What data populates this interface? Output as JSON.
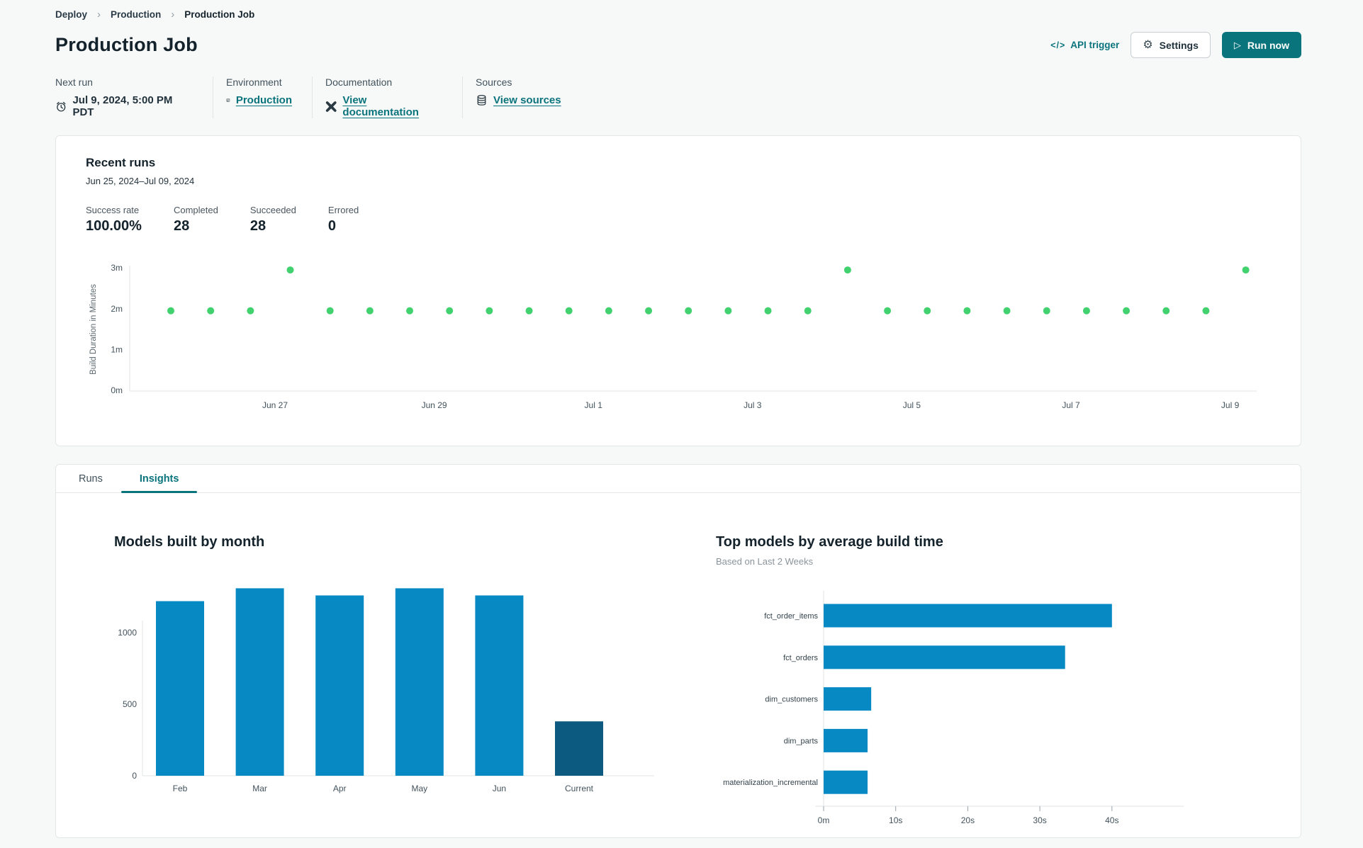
{
  "breadcrumb": {
    "items": [
      "Deploy",
      "Production",
      "Production Job"
    ],
    "separator": "›"
  },
  "header": {
    "title": "Production Job",
    "api_trigger": {
      "glyph": "</>",
      "label": "API trigger"
    },
    "settings": {
      "glyph": "⚙",
      "label": "Settings"
    },
    "run_now": {
      "glyph": "▷",
      "label": "Run now"
    }
  },
  "meta": {
    "next_run": {
      "label": "Next run",
      "value": "Jul 9, 2024, 5:00 PM PDT"
    },
    "environment": {
      "label": "Environment",
      "value": "Production"
    },
    "documentation": {
      "label": "Documentation",
      "value": "View documentation"
    },
    "sources": {
      "label": "Sources",
      "value": "View sources"
    }
  },
  "recent_runs": {
    "title": "Recent runs",
    "date_range": "Jun 25, 2024–Jul 09, 2024",
    "stats": [
      {
        "label": "Success rate",
        "value": "100.00%"
      },
      {
        "label": "Completed",
        "value": "28"
      },
      {
        "label": "Succeeded",
        "value": "28"
      },
      {
        "label": "Errored",
        "value": "0"
      }
    ]
  },
  "tabs": [
    {
      "label": "Runs",
      "active": false
    },
    {
      "label": "Insights",
      "active": true
    }
  ],
  "colors": {
    "accent_teal": "#0a747c",
    "dot_green": "#41d16e",
    "bar_blue": "#0789c4",
    "bar_navy": "#0d5a80",
    "axis_gray": "#e1e4e6"
  },
  "chart_data": [
    {
      "id": "recent-runs-build-duration",
      "type": "scatter",
      "ylabel": "Build Duration in Minutes",
      "y_tick_labels": [
        "0m",
        "1m",
        "2m",
        "3m"
      ],
      "y_tick_values": [
        0,
        1,
        2,
        3
      ],
      "ylim": [
        0,
        3.2
      ],
      "x_tick_labels": [
        "Jun 27",
        "Jun 29",
        "Jul 1",
        "Jul 3",
        "Jul 5",
        "Jul 7",
        "Jul 9"
      ],
      "point_color": "#41d16e",
      "grid": false,
      "points_minutes": [
        1.95,
        1.95,
        1.95,
        2.95,
        1.95,
        1.95,
        1.95,
        1.95,
        1.95,
        1.95,
        1.95,
        1.95,
        1.95,
        1.95,
        1.95,
        1.95,
        1.95,
        2.95,
        1.95,
        1.95,
        1.95,
        1.95,
        1.95,
        1.95,
        1.95,
        1.95,
        1.95,
        2.95
      ]
    },
    {
      "id": "models-built-by-month",
      "type": "bar",
      "title": "Models built by month",
      "categories": [
        "Feb",
        "Mar",
        "Apr",
        "May",
        "Jun",
        "Current"
      ],
      "values": [
        1220,
        1310,
        1260,
        1310,
        1260,
        380
      ],
      "bar_colors": [
        "#0789c4",
        "#0789c4",
        "#0789c4",
        "#0789c4",
        "#0789c4",
        "#0d5a80"
      ],
      "y_ticks": [
        0,
        500,
        1000
      ],
      "ylim": [
        0,
        1420
      ],
      "grid": false
    },
    {
      "id": "top-models-by-average-build-time",
      "type": "bar-horizontal",
      "title": "Top models by average build time",
      "subtitle": "Based on Last 2 Weeks",
      "categories": [
        "fct_order_items",
        "fct_orders",
        "dim_customers",
        "dim_parts",
        "materialization_incremental"
      ],
      "values_seconds": [
        40,
        33.5,
        6.6,
        6.1,
        6.1
      ],
      "x_tick_labels": [
        "0m",
        "10s",
        "20s",
        "30s",
        "40s"
      ],
      "x_tick_values": [
        0,
        10,
        20,
        30,
        40
      ],
      "xlim": [
        0,
        45
      ],
      "bar_color": "#0789c4",
      "grid": false
    }
  ]
}
